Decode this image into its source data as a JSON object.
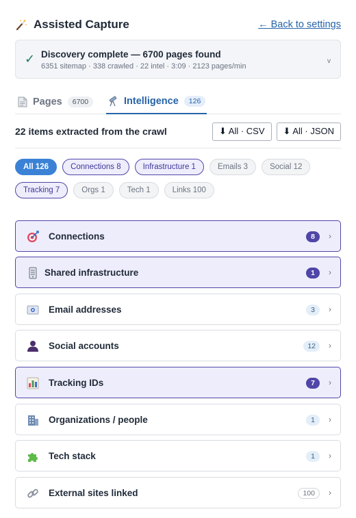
{
  "header": {
    "title": "Assisted Capture",
    "back_link": "← Back to settings",
    "icon": "magic-wand-icon"
  },
  "status": {
    "title": "Discovery complete — 6700 pages found",
    "subtitle": "6351 sitemap · 338 crawled · 22 intel · 3:09 · 2123 pages/min",
    "check": "✓",
    "caret": "v"
  },
  "tabs": [
    {
      "label": "Pages",
      "count": "6700",
      "icon": "document-icon"
    },
    {
      "label": "Intelligence",
      "count": "126",
      "icon": "telescope-icon",
      "active": true
    }
  ],
  "toolbar": {
    "summary": "22 items extracted from the crawl",
    "csv_label": "⬇ All · CSV",
    "json_label": "⬇ All · JSON"
  },
  "filters": [
    {
      "label": "All 126",
      "state": "active"
    },
    {
      "label": "Connections 8",
      "state": "highlighted"
    },
    {
      "label": "Infrastructure 1",
      "state": "highlighted"
    },
    {
      "label": "Emails 3",
      "state": "normal"
    },
    {
      "label": "Social 12",
      "state": "normal"
    },
    {
      "label": "Tracking 7",
      "state": "highlighted"
    },
    {
      "label": "Orgs 1",
      "state": "normal"
    },
    {
      "label": "Tech 1",
      "state": "normal"
    },
    {
      "label": "Links 100",
      "state": "normal"
    }
  ],
  "categories": [
    {
      "label": "Connections",
      "count": "8",
      "icon": "target-icon",
      "highlighted": true
    },
    {
      "label": "Shared infrastructure",
      "count": "1",
      "icon": "server-icon",
      "highlighted": true
    },
    {
      "label": "Email addresses",
      "count": "3",
      "icon": "envelope-icon",
      "highlighted": false
    },
    {
      "label": "Social accounts",
      "count": "12",
      "icon": "person-icon",
      "highlighted": false
    },
    {
      "label": "Tracking IDs",
      "count": "7",
      "icon": "bar-chart-icon",
      "highlighted": true
    },
    {
      "label": "Organizations / people",
      "count": "1",
      "icon": "office-building-icon",
      "highlighted": false
    },
    {
      "label": "Tech stack",
      "count": "1",
      "icon": "puzzle-piece-icon",
      "highlighted": false
    },
    {
      "label": "External sites linked",
      "count": "100",
      "icon": "link-icon",
      "highlighted": false
    }
  ],
  "chevron": "›",
  "colors": {
    "accent": "#2563a8",
    "highlight_border": "#4f46a8",
    "highlight_bg": "#eeedfc",
    "active_chip": "#3b82d6",
    "success": "#1e7a5a"
  }
}
